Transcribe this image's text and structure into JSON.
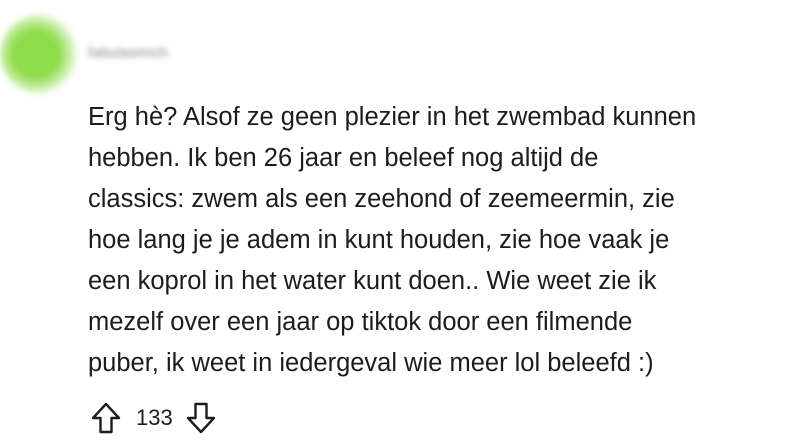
{
  "comment": {
    "username": "fabulasmich",
    "body_lines": [
      "Erg hè? Alsof ze geen plezier in het zwembad kunnen",
      "hebben. Ik ben 26 jaar en beleef nog altijd de",
      "classics: zwem als een zeehond of zeemeermin, zie",
      "hoe lang je je adem in kunt houden, zie hoe vaak je",
      "een koprol in het water kunt doen.. Wie weet zie ik",
      "mezelf over een jaar op tiktok door een filmende",
      "puber, ik weet in iedergeval wie meer lol beleefd :)"
    ],
    "vote_count": "133",
    "icons": {
      "upvote": "arrow-up-outline-icon",
      "downvote": "arrow-down-outline-icon"
    },
    "colors": {
      "avatar": "#8ddc4a",
      "text": "#1c1c1c"
    }
  }
}
